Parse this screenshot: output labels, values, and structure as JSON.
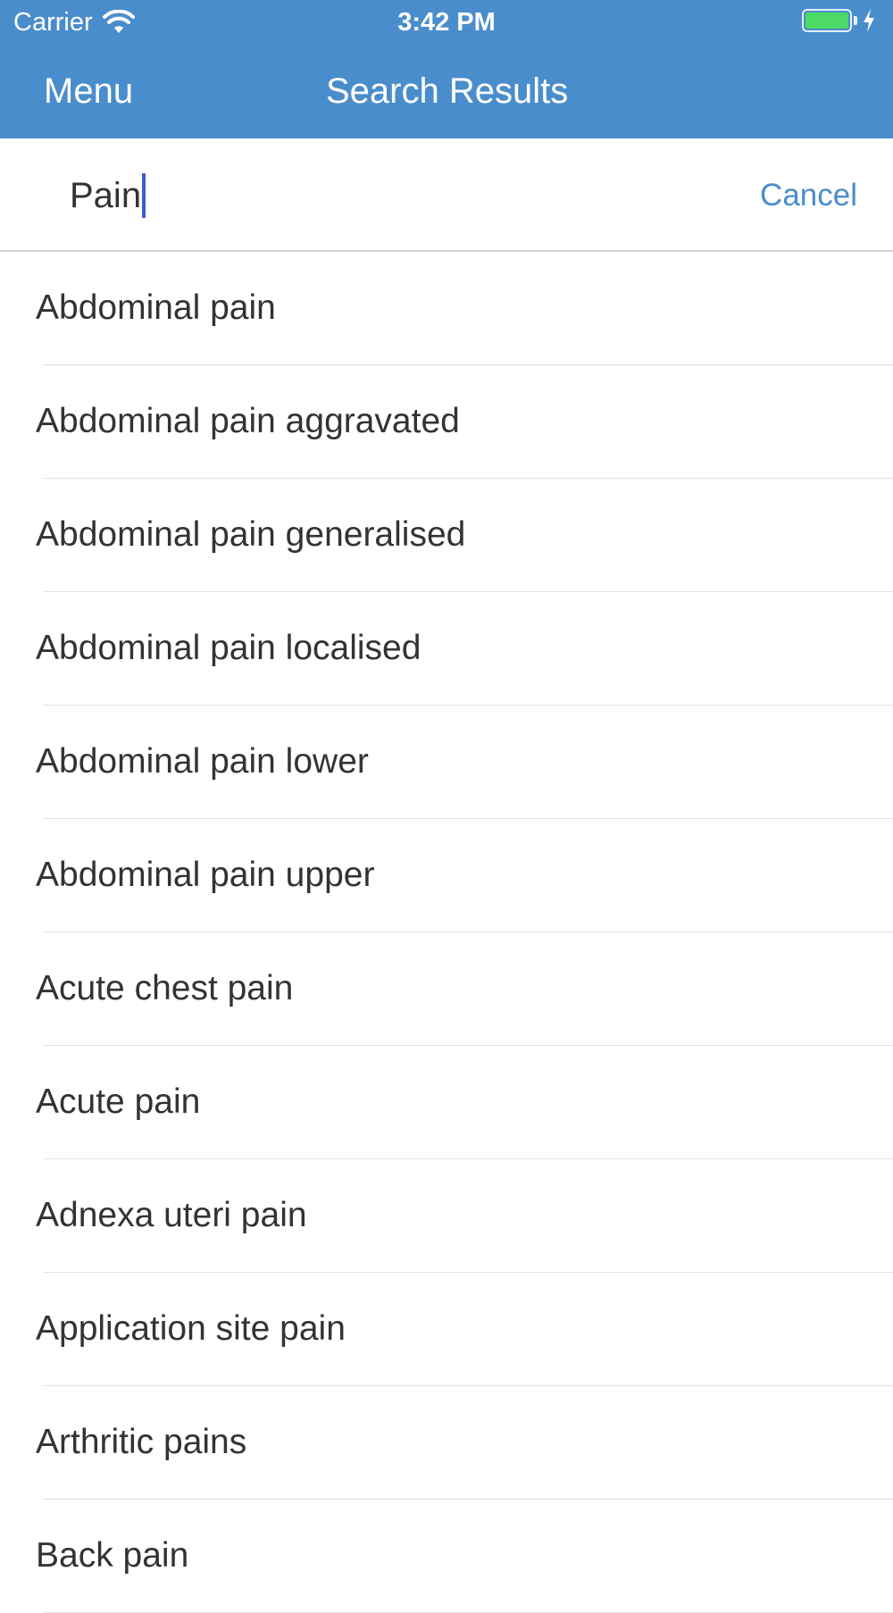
{
  "status_bar": {
    "carrier": "Carrier",
    "time": "3:42 PM",
    "icons": [
      "wifi-icon",
      "battery-icon",
      "charging-bolt-icon"
    ],
    "battery_color": "#4cd964"
  },
  "nav": {
    "menu_label": "Menu",
    "title": "Search Results",
    "background_color": "#4a8dcc"
  },
  "search": {
    "value": "Pain",
    "cancel_label": "Cancel",
    "accent_color": "#4a8dcc"
  },
  "results": [
    "Abdominal pain",
    "Abdominal pain aggravated",
    "Abdominal pain generalised",
    "Abdominal pain localised",
    "Abdominal pain lower",
    "Abdominal pain upper",
    "Acute chest pain",
    "Acute pain",
    "Adnexa uteri pain",
    "Application site pain",
    "Arthritic pains",
    "Back pain"
  ]
}
